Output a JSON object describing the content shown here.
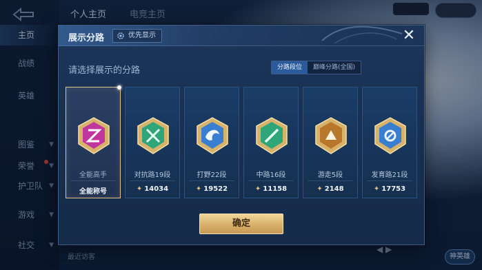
{
  "background": {
    "tabs": [
      "个人主页",
      "电竞主页"
    ],
    "sidebar": [
      {
        "label": "主页",
        "active": true,
        "chevron": false,
        "dot": false
      },
      {
        "label": "战绩",
        "active": false,
        "chevron": false,
        "dot": false
      },
      {
        "label": "英雄",
        "active": false,
        "chevron": false,
        "dot": false
      },
      {
        "label": "图鉴",
        "active": false,
        "chevron": true,
        "dot": false
      },
      {
        "label": "荣誉",
        "active": false,
        "chevron": true,
        "dot": true
      },
      {
        "label": "护卫队",
        "active": false,
        "chevron": true,
        "dot": false
      },
      {
        "label": "游戏",
        "active": false,
        "chevron": true,
        "dot": false
      },
      {
        "label": "社交",
        "active": false,
        "chevron": true,
        "dot": false
      }
    ],
    "visitors": "最近访客",
    "hero_button": "神英雄"
  },
  "dialog": {
    "title": "展示分路",
    "priority_label": "优先显示",
    "prompt": "请选择展示的分路",
    "segments": [
      {
        "label": "分路段位",
        "active": true
      },
      {
        "label": "巅峰分路(全国)",
        "active": false
      }
    ],
    "cards": [
      {
        "lane": "全能高手",
        "score": "全能称号",
        "show_points": false,
        "selected": true,
        "emblem": "allround-emblem-icon",
        "color": "#c0369e"
      },
      {
        "lane": "对抗路19段",
        "score": "14034",
        "show_points": true,
        "selected": false,
        "emblem": "clash-lane-emblem-icon",
        "color": "#2fa57a"
      },
      {
        "lane": "打野22段",
        "score": "19522",
        "show_points": true,
        "selected": false,
        "emblem": "jungle-emblem-icon",
        "color": "#3a7ed0"
      },
      {
        "lane": "中路16段",
        "score": "11158",
        "show_points": true,
        "selected": false,
        "emblem": "mid-lane-emblem-icon",
        "color": "#2fa57a"
      },
      {
        "lane": "游走5段",
        "score": "2148",
        "show_points": true,
        "selected": false,
        "emblem": "roam-emblem-icon",
        "color": "#b9772c"
      },
      {
        "lane": "发育路21段",
        "score": "17753",
        "show_points": true,
        "selected": false,
        "emblem": "farm-lane-emblem-icon",
        "color": "#3a7ed0"
      }
    ],
    "confirm_label": "确定",
    "close_glyph": "✕"
  }
}
